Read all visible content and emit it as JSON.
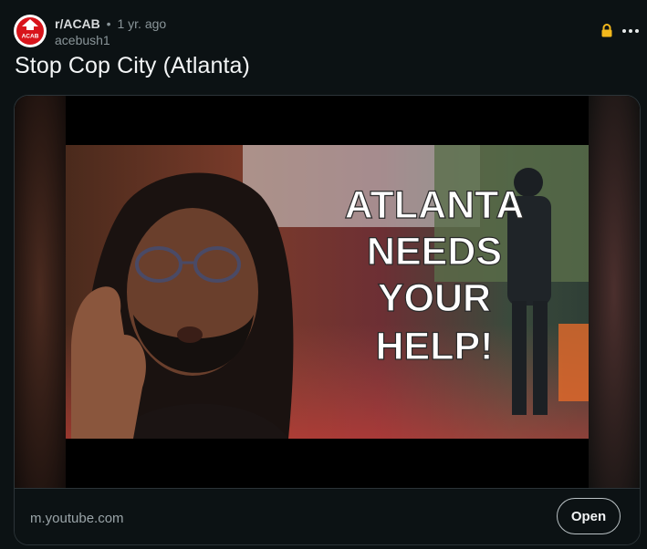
{
  "post": {
    "subreddit": "r/ACAB",
    "separator": "•",
    "age": "1 yr. ago",
    "author": "acebush1",
    "title": "Stop Cop City (Atlanta)",
    "avatar_text": "ACAB",
    "icons": {
      "lock": "lock-icon",
      "more": "more-options-icon"
    },
    "colors": {
      "avatar_red": "#d8141b",
      "lock": "#f3b81c",
      "thumb_text": "#ffffff"
    }
  },
  "embed": {
    "thumbnail_text": [
      "ATLANTA",
      "NEEDS",
      "YOUR",
      "HELP!"
    ],
    "domain": "m.youtube.com",
    "open_label": "Open"
  }
}
